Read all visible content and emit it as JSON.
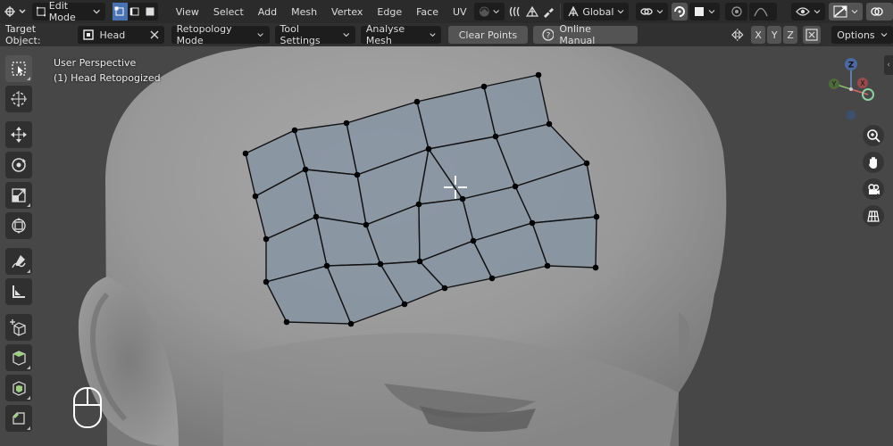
{
  "header": {
    "mode_label": "Edit Mode",
    "menus": [
      "View",
      "Select",
      "Add",
      "Mesh",
      "Vertex",
      "Edge",
      "Face",
      "UV"
    ],
    "orientation_label": "Global"
  },
  "tool_header": {
    "target_label": "Target Object:",
    "target_value": "Head",
    "retopology_mode_label": "Retopology Mode",
    "tool_settings_label": "Tool Settings",
    "analyse_mesh_label": "Analyse Mesh",
    "clear_points_label": "Clear Points",
    "online_manual_label": "Online Manual",
    "axes": [
      "X",
      "Y",
      "Z"
    ],
    "options_label": "Options"
  },
  "viewport": {
    "perspective_label": "User Perspective",
    "object_label": "(1) Head Retopogized"
  },
  "gizmo": {
    "axis_z": "Z",
    "axis_y": "Y",
    "axis_x": "X"
  },
  "colors": {
    "accent": "#4772b3",
    "mesh_face": "#8794a3",
    "background": "#474747"
  },
  "icons": {
    "toolbar": [
      "select-box-icon",
      "cursor-icon",
      "move-icon",
      "rotate-icon",
      "scale-icon",
      "transform-icon",
      "annotate-icon",
      "measure-icon",
      "add-cube-icon",
      "extrude-icon",
      "inset-icon",
      "bevel-icon"
    ],
    "navigation": [
      "zoom-icon",
      "pan-hand-icon",
      "camera-icon",
      "grid-icon"
    ]
  }
}
